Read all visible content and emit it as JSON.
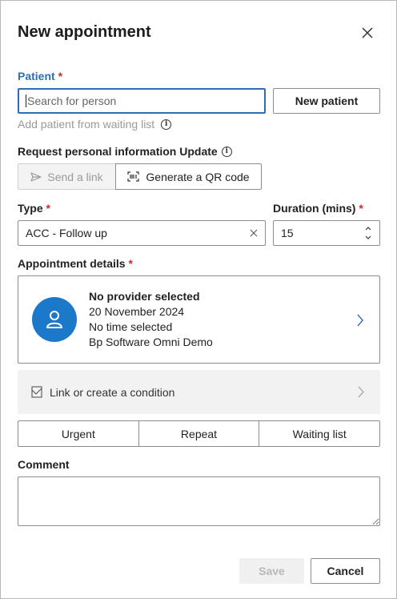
{
  "dialog": {
    "title": "New appointment",
    "close_icon": "close-icon"
  },
  "patient": {
    "label": "Patient",
    "required_mark": "*",
    "search_placeholder": "Search for person",
    "new_patient_label": "New patient",
    "waiting_list_link": "Add patient from waiting list"
  },
  "personal_info": {
    "label": "Request personal information Update",
    "send_link_label": "Send a link",
    "qr_label": "Generate a QR code"
  },
  "type": {
    "label": "Type",
    "required_mark": "*",
    "value": "ACC - Follow up"
  },
  "duration": {
    "label": "Duration (mins)",
    "required_mark": "*",
    "value": "15"
  },
  "appointment_details": {
    "label": "Appointment details",
    "required_mark": "*",
    "provider": "No provider selected",
    "date": "20 November 2024",
    "time": "No time selected",
    "location": "Bp Software Omni Demo"
  },
  "condition": {
    "label": "Link or create a condition"
  },
  "flags": {
    "urgent": "Urgent",
    "repeat": "Repeat",
    "waiting_list": "Waiting list"
  },
  "comment": {
    "label": "Comment",
    "value": ""
  },
  "footer": {
    "save_label": "Save",
    "cancel_label": "Cancel"
  },
  "colors": {
    "accent": "#2d6fb5",
    "avatar": "#1c78c9",
    "required": "#c4302b"
  }
}
